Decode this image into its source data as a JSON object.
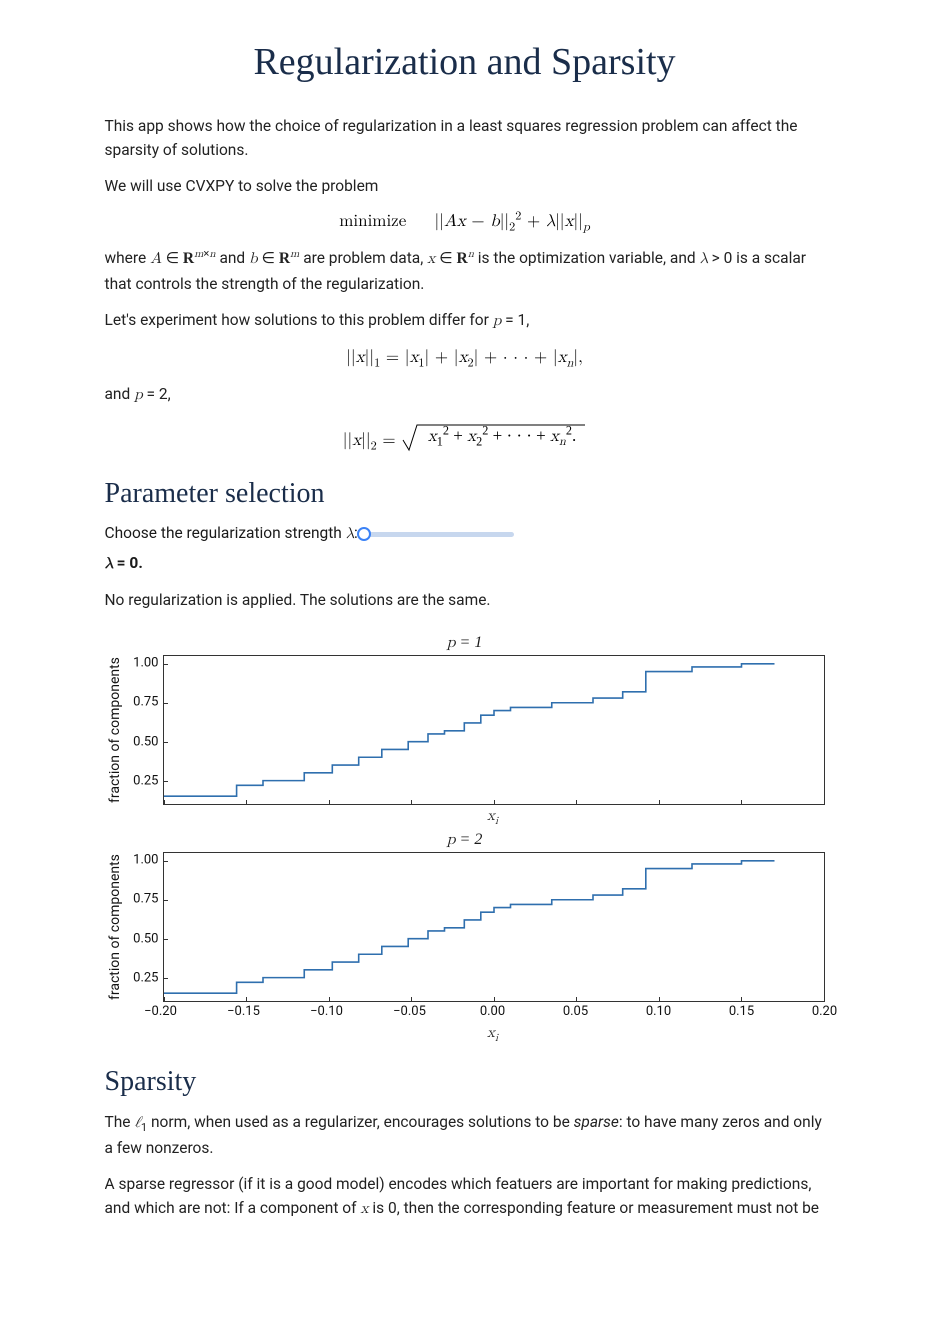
{
  "title": "Regularization and Sparsity",
  "intro_p1": "This app shows how the choice of regularization in a least squares regression problem can affect the sparsity of solutions.",
  "intro_p2": "We will use CVXPY to solve the problem",
  "math": {
    "objective_label": "minimize",
    "objective_expr_html": "||<span class='mathvar'>A</span><span class='mathvar'>x</span> − <span class='mathvar'>b</span>||<sub>2</sub><sup>2</sup> + <span class='mathvar'>λ</span>||<span class='mathvar'>x</span>||<sub><span class='mathvar'>p</span></sub>",
    "where_html": "where <span class='mathvar'>A</span> ∈ <span class='bold-R'>R</span><sup><span class='mathvar'>m</span>×<span class='mathvar'>n</span></sup> and <span class='mathvar'>b</span> ∈ <span class='bold-R'>R</span><sup><span class='mathvar'>m</span></sup> are problem data, <span class='mathvar'>x</span> ∈ <span class='bold-R'>R</span><sup><span class='mathvar'>n</span></sup> is the optimization variable, and <span class='mathvar'>λ</span> &gt; 0 is a scalar that controls the strength of the regularization.",
    "experiment_html": "Let's experiment how solutions to this problem differ for <span class='mathvar'>p</span> = 1,",
    "l1_norm_html": "||<span class='mathvar'>x</span>||<sub>1</sub> = |<span class='mathvar'>x</span><sub>1</sub>| + |<span class='mathvar'>x</span><sub>2</sub>| + · · · + |<span class='mathvar'>x</span><sub><span class='mathvar'>n</span></sub>|,",
    "and_p2_html": "and <span class='mathvar'>p</span> = 2,",
    "l2_norm_inner_html": "<span class='mathvar'>x</span><sub>1</sub><sup>2</sup> + <span class='mathvar'>x</span><sub>2</sub><sup>2</sup> + · · · + <span class='mathvar'>x</span><sub><span class='mathvar'>n</span></sub><sup>2</sup>.",
    "l2_norm_prefix_html": "||<span class='mathvar'>x</span>||<sub>2</sub> = "
  },
  "param_section": {
    "heading": "Parameter selection",
    "prompt_html": "Choose the regularization strength <span class='mathvar'>λ</span>:",
    "lambda_value_html": "<span class='mathvar'>λ</span> = 0.",
    "no_reg_text": "No regularization is applied. The solutions are the same.",
    "slider": {
      "min": 0,
      "max": 1,
      "value": 0
    }
  },
  "chart_data": [
    {
      "type": "line",
      "title": "p = 1",
      "xlabel": "xᵢ",
      "ylabel": "fraction of components",
      "xlim": [
        -0.2,
        0.2
      ],
      "ylim": [
        0.1,
        1.05
      ],
      "yticks": [
        1.0,
        0.75,
        0.5,
        0.25
      ],
      "step_points": [
        [
          -0.2,
          0.15
        ],
        [
          -0.156,
          0.15
        ],
        [
          -0.156,
          0.22
        ],
        [
          -0.14,
          0.22
        ],
        [
          -0.14,
          0.25
        ],
        [
          -0.115,
          0.25
        ],
        [
          -0.115,
          0.3
        ],
        [
          -0.098,
          0.3
        ],
        [
          -0.098,
          0.35
        ],
        [
          -0.082,
          0.35
        ],
        [
          -0.082,
          0.4
        ],
        [
          -0.068,
          0.4
        ],
        [
          -0.068,
          0.45
        ],
        [
          -0.052,
          0.45
        ],
        [
          -0.052,
          0.5
        ],
        [
          -0.04,
          0.5
        ],
        [
          -0.04,
          0.55
        ],
        [
          -0.03,
          0.55
        ],
        [
          -0.03,
          0.57
        ],
        [
          -0.018,
          0.57
        ],
        [
          -0.018,
          0.62
        ],
        [
          -0.008,
          0.62
        ],
        [
          -0.008,
          0.67
        ],
        [
          0.0,
          0.67
        ],
        [
          0.0,
          0.7
        ],
        [
          0.01,
          0.7
        ],
        [
          0.01,
          0.72
        ],
        [
          0.035,
          0.72
        ],
        [
          0.035,
          0.75
        ],
        [
          0.06,
          0.75
        ],
        [
          0.06,
          0.78
        ],
        [
          0.078,
          0.78
        ],
        [
          0.078,
          0.82
        ],
        [
          0.092,
          0.82
        ],
        [
          0.092,
          0.95
        ],
        [
          0.12,
          0.95
        ],
        [
          0.12,
          0.98
        ],
        [
          0.15,
          0.98
        ],
        [
          0.15,
          1.0
        ],
        [
          0.17,
          1.0
        ]
      ]
    },
    {
      "type": "line",
      "title": "p = 2",
      "xlabel": "xᵢ",
      "ylabel": "fraction of components",
      "xlim": [
        -0.2,
        0.2
      ],
      "ylim": [
        0.1,
        1.05
      ],
      "yticks": [
        1.0,
        0.75,
        0.5,
        0.25
      ],
      "xticks": [
        "−0.20",
        "−0.15",
        "−0.10",
        "−0.05",
        "0.00",
        "0.05",
        "0.10",
        "0.15",
        "0.20"
      ],
      "step_points": [
        [
          -0.2,
          0.15
        ],
        [
          -0.156,
          0.15
        ],
        [
          -0.156,
          0.22
        ],
        [
          -0.14,
          0.22
        ],
        [
          -0.14,
          0.25
        ],
        [
          -0.115,
          0.25
        ],
        [
          -0.115,
          0.3
        ],
        [
          -0.098,
          0.3
        ],
        [
          -0.098,
          0.35
        ],
        [
          -0.082,
          0.35
        ],
        [
          -0.082,
          0.4
        ],
        [
          -0.068,
          0.4
        ],
        [
          -0.068,
          0.45
        ],
        [
          -0.052,
          0.45
        ],
        [
          -0.052,
          0.5
        ],
        [
          -0.04,
          0.5
        ],
        [
          -0.04,
          0.55
        ],
        [
          -0.03,
          0.55
        ],
        [
          -0.03,
          0.57
        ],
        [
          -0.018,
          0.57
        ],
        [
          -0.018,
          0.62
        ],
        [
          -0.008,
          0.62
        ],
        [
          -0.008,
          0.67
        ],
        [
          0.0,
          0.67
        ],
        [
          0.0,
          0.7
        ],
        [
          0.01,
          0.7
        ],
        [
          0.01,
          0.72
        ],
        [
          0.035,
          0.72
        ],
        [
          0.035,
          0.75
        ],
        [
          0.06,
          0.75
        ],
        [
          0.06,
          0.78
        ],
        [
          0.078,
          0.78
        ],
        [
          0.078,
          0.82
        ],
        [
          0.092,
          0.82
        ],
        [
          0.092,
          0.95
        ],
        [
          0.12,
          0.95
        ],
        [
          0.12,
          0.98
        ],
        [
          0.15,
          0.98
        ],
        [
          0.15,
          1.0
        ],
        [
          0.17,
          1.0
        ]
      ]
    }
  ],
  "sparsity_section": {
    "heading": "Sparsity",
    "p1_html": "The <span class='mathvar'>ℓ</span><sub>1</sub> norm, when used as a regularizer, encourages solutions to be <em>sparse</em>: to have many zeros and only a few nonzeros.",
    "p2_html": "A sparse regressor (if it is a good model) encodes which featuers are important for making predictions, and which are not: If a component of <span class='mathvar'>x</span> is 0, then the corresponding feature or measurement must not be important in making predictions"
  }
}
